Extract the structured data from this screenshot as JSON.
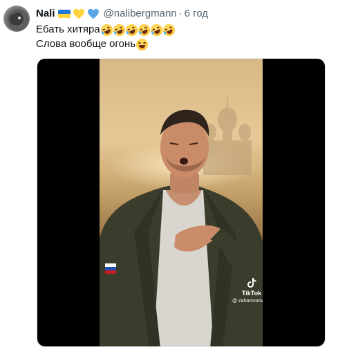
{
  "tweet": {
    "author_name": "Nali",
    "author_handle": "@nalibergmann",
    "separator": "·",
    "time": "6 год",
    "line1_text": "Ебать хитяра",
    "line1_emoji": [
      "rofl",
      "rofl",
      "rofl",
      "rofl",
      "rofl",
      "rofl"
    ],
    "line2_text": "Слова вообще огонь",
    "line2_emoji": [
      "grin-squint"
    ]
  },
  "media": {
    "watermark_brand": "TikTok",
    "watermark_handle": "@ zaharsvoov"
  },
  "colors": {
    "text": "#0f1419",
    "secondary": "#536471",
    "flag_blue": "#1f77d8",
    "flag_yellow": "#ffd43b",
    "heart_yellow": "#ffd43b",
    "heart_blue": "#5aa7e8"
  }
}
